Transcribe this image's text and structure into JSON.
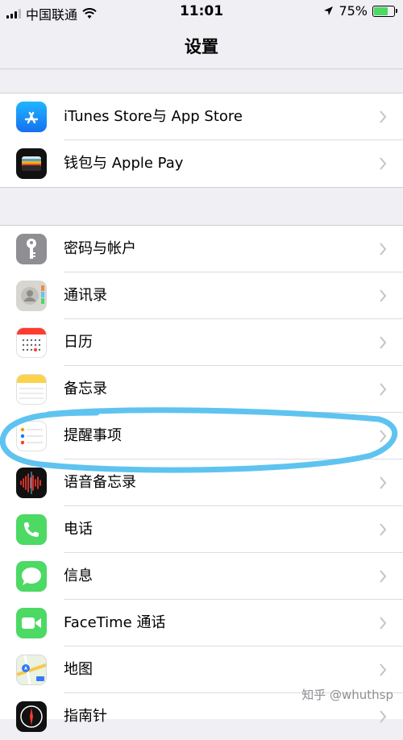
{
  "status_bar": {
    "carrier": "中国联通",
    "time": "11:01",
    "battery": "75%",
    "battery_level": 0.75
  },
  "nav": {
    "title": "设置"
  },
  "groups": [
    {
      "items": [
        {
          "label": "iTunes Store与 App Store",
          "icon": "app-store-icon"
        },
        {
          "label": "钱包与 Apple Pay",
          "icon": "wallet-icon"
        }
      ]
    },
    {
      "items": [
        {
          "label": "密码与帐户",
          "icon": "key-icon"
        },
        {
          "label": "通讯录",
          "icon": "contacts-icon"
        },
        {
          "label": "日历",
          "icon": "calendar-icon"
        },
        {
          "label": "备忘录",
          "icon": "notes-icon"
        },
        {
          "label": "提醒事项",
          "icon": "reminders-icon"
        },
        {
          "label": "语音备忘录",
          "icon": "voice-memos-icon"
        },
        {
          "label": "电话",
          "icon": "phone-icon"
        },
        {
          "label": "信息",
          "icon": "messages-icon"
        },
        {
          "label": "FaceTime 通话",
          "icon": "facetime-icon"
        },
        {
          "label": "地图",
          "icon": "maps-icon"
        },
        {
          "label": "指南针",
          "icon": "compass-icon"
        }
      ]
    }
  ],
  "watermark": "知乎 @whuthsp",
  "colors": {
    "app_store": "#1a8cff",
    "phone_green": "#4cd964",
    "annotation": "#5fc3f0"
  }
}
